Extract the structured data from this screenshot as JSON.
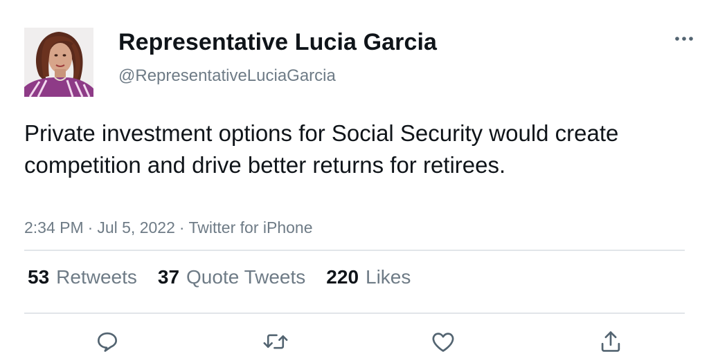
{
  "author": {
    "display_name": "Representative Lucia Garcia",
    "handle": "@RepresentativeLuciaGarcia",
    "avatar_icon": "profile-photo"
  },
  "tweet": {
    "text": "Private investment options for Social Security would create competition and drive better returns for retirees.",
    "time": "2:34 PM",
    "date": "Jul 5, 2022",
    "separator": "·",
    "source": "Twitter for iPhone"
  },
  "stats": {
    "retweets_count": "53",
    "retweets_label": "Retweets",
    "quotes_count": "37",
    "quotes_label": "Quote Tweets",
    "likes_count": "220",
    "likes_label": "Likes"
  },
  "actions": {
    "reply_icon": "reply-icon",
    "retweet_icon": "retweet-icon",
    "like_icon": "like-icon",
    "share_icon": "share-icon",
    "more_icon": "more-options-icon"
  },
  "colors": {
    "text": "#0f1419",
    "secondary_text": "#6e7b86",
    "divider": "#e1e5e9",
    "icon": "#536471"
  }
}
